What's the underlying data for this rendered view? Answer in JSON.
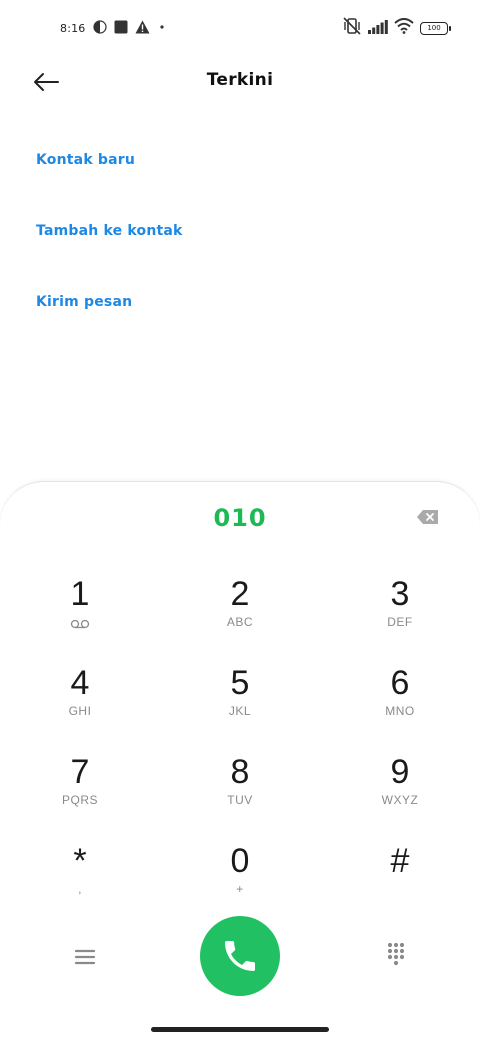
{
  "status_bar": {
    "time": "8:16",
    "battery_level": "100",
    "icons": [
      "data-saver-icon",
      "square-notification-icon",
      "warning-icon",
      "dot-icon",
      "vibrate-off-icon",
      "signal-icon",
      "wifi-icon",
      "battery-icon"
    ]
  },
  "header": {
    "title": "Terkini",
    "back_icon": "arrow-left-icon"
  },
  "actions": [
    {
      "label": "Kontak baru"
    },
    {
      "label": "Tambah ke kontak"
    },
    {
      "label": "Kirim pesan"
    }
  ],
  "colors": {
    "link": "#1e88e5",
    "dialed_number": "#1db954",
    "call_button": "#21c063"
  },
  "dialpad": {
    "number": "010",
    "backspace_icon": "backspace-icon",
    "keys": [
      {
        "digit": "1",
        "letters": ""
      },
      {
        "digit": "2",
        "letters": "ABC"
      },
      {
        "digit": "3",
        "letters": "DEF"
      },
      {
        "digit": "4",
        "letters": "GHI"
      },
      {
        "digit": "5",
        "letters": "JKL"
      },
      {
        "digit": "6",
        "letters": "MNO"
      },
      {
        "digit": "7",
        "letters": "PQRS"
      },
      {
        "digit": "8",
        "letters": "TUV"
      },
      {
        "digit": "9",
        "letters": "WXYZ"
      },
      {
        "digit": "*",
        "letters": ","
      },
      {
        "digit": "0",
        "letters": "+"
      },
      {
        "digit": "#",
        "letters": ""
      }
    ],
    "bottom_icons": [
      "menu-icon",
      "phone-icon",
      "dialpad-icon"
    ]
  }
}
